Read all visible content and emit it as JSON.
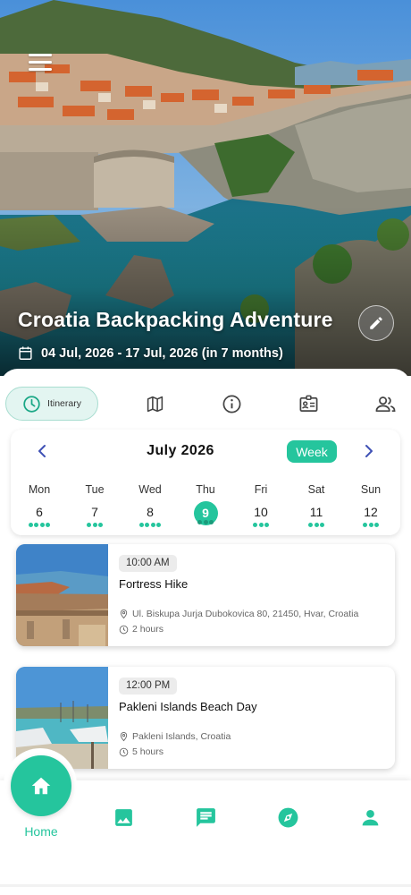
{
  "hero": {
    "title": "Croatia Backpacking Adventure",
    "dates": "04 Jul, 2026 - 17 Jul, 2026 (in 7 months)"
  },
  "tabs": [
    {
      "label": "Itinerary",
      "icon": "clock-icon",
      "active": true
    },
    {
      "label": "",
      "icon": "map-icon"
    },
    {
      "label": "",
      "icon": "info-icon"
    },
    {
      "label": "",
      "icon": "id-card-icon"
    },
    {
      "label": "",
      "icon": "people-icon"
    }
  ],
  "calendar": {
    "month": "July 2026",
    "view_button": "Week",
    "days": [
      {
        "name": "Mon",
        "num": "6",
        "dots": 4
      },
      {
        "name": "Tue",
        "num": "7",
        "dots": 3
      },
      {
        "name": "Wed",
        "num": "8",
        "dots": 4
      },
      {
        "name": "Thu",
        "num": "9",
        "dots": 3,
        "selected": true
      },
      {
        "name": "Fri",
        "num": "10",
        "dots": 3
      },
      {
        "name": "Sat",
        "num": "11",
        "dots": 3
      },
      {
        "name": "Sun",
        "num": "12",
        "dots": 3
      }
    ]
  },
  "activities": [
    {
      "time": "10:00 AM",
      "title": "Fortress Hike",
      "location": "Ul. Biskupa Jurja Dubokovica 80, 21450, Hvar, Croatia",
      "duration": "2 hours"
    },
    {
      "time": "12:00 PM",
      "title": "Pakleni Islands Beach Day",
      "location": "Pakleni Islands, Croatia",
      "duration": "5 hours"
    }
  ],
  "nav": {
    "home_label": "Home",
    "items": [
      "photo-icon",
      "chat-icon",
      "compass-icon",
      "person-icon"
    ]
  },
  "colors": {
    "accent": "#25c59d"
  }
}
